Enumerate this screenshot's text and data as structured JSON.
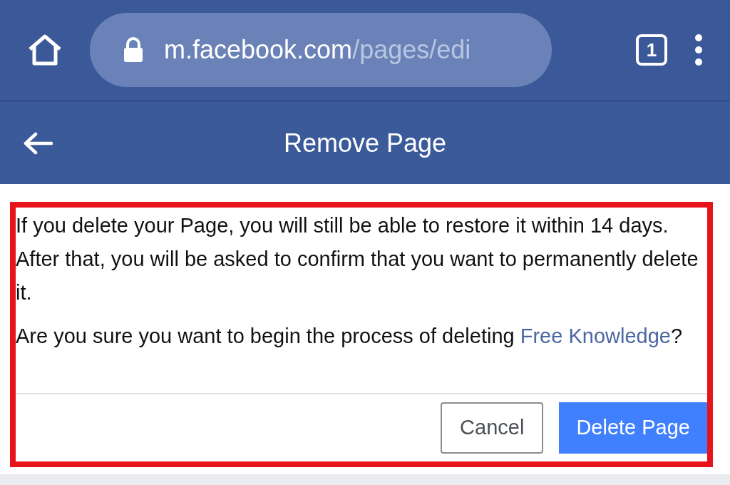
{
  "browser": {
    "url": {
      "host": "m.facebook.com",
      "path": "/pages/edi"
    },
    "tab_count": "1"
  },
  "header": {
    "title": "Remove Page"
  },
  "dialog": {
    "paragraphs": [
      "If you delete your Page, you will still be able to restore it within 14 days. After that, you will be asked to confirm that you want to permanently delete it."
    ],
    "question": {
      "text": "Are you sure you want to begin the process of deleting",
      "link": "Free Knowledge",
      "end": "?"
    },
    "buttons": [
      {
        "label": "Cancel",
        "kind": "secondary"
      },
      {
        "label": "Delete Page",
        "kind": "primary"
      }
    ]
  }
}
